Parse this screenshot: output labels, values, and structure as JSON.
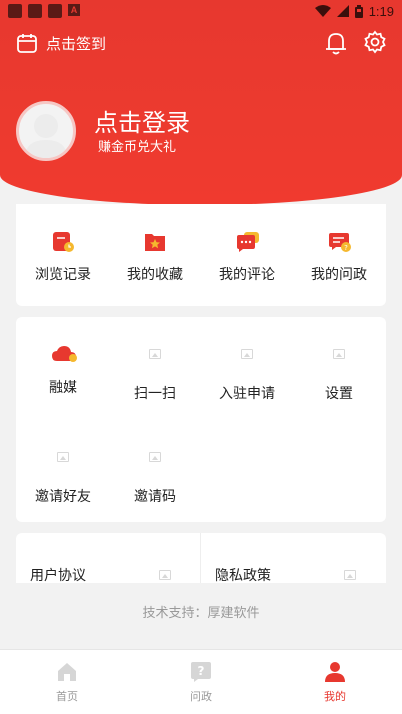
{
  "status_bar": {
    "time": "1:19",
    "notif_icon_letter": "A"
  },
  "header": {
    "signin_label": "点击签到",
    "login_title": "点击登录",
    "login_subtitle": "赚金币兑大礼"
  },
  "quick_actions": [
    {
      "label": "浏览记录",
      "icon": "history-icon"
    },
    {
      "label": "我的收藏",
      "icon": "favorites-icon"
    },
    {
      "label": "我的评论",
      "icon": "comments-icon"
    },
    {
      "label": "我的问政",
      "icon": "inquiries-icon"
    }
  ],
  "services": [
    {
      "label": "融媒",
      "icon": "media-cloud-icon"
    },
    {
      "label": "扫一扫",
      "icon": "scan-icon"
    },
    {
      "label": "入驻申请",
      "icon": "apply-icon"
    },
    {
      "label": "设置",
      "icon": "settings-icon"
    },
    {
      "label": "邀请好友",
      "icon": "invite-friends-icon"
    },
    {
      "label": "邀请码",
      "icon": "invite-code-icon"
    }
  ],
  "agreements": [
    {
      "label": "用户协议"
    },
    {
      "label": "隐私政策"
    }
  ],
  "support_text": "技术支持：厚建软件",
  "tabs": [
    {
      "label": "首页",
      "icon": "home-icon",
      "active": false
    },
    {
      "label": "问政",
      "icon": "question-icon",
      "active": false
    },
    {
      "label": "我的",
      "icon": "profile-icon",
      "active": true
    }
  ],
  "colors": {
    "brand_red": "#e7382f",
    "icon_yellow": "#f5b82e",
    "tab_inactive": "#9a9a9a"
  }
}
